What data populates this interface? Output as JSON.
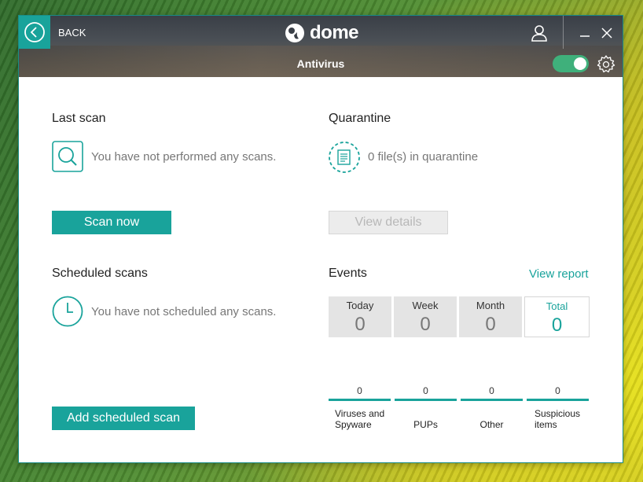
{
  "header": {
    "back_label": "BACK",
    "logo_text": "dome",
    "logo_small": "panda",
    "title": "Antivirus",
    "toggle_on": true
  },
  "last_scan": {
    "title": "Last scan",
    "message": "You have not performed any scans.",
    "button": "Scan now"
  },
  "quarantine": {
    "title": "Quarantine",
    "message": "0 file(s) in quarantine",
    "button": "View details"
  },
  "scheduled": {
    "title": "Scheduled scans",
    "message": "You have not scheduled any scans.",
    "button": "Add scheduled scan"
  },
  "events": {
    "title": "Events",
    "view_report": "View report",
    "periods": [
      {
        "label": "Today",
        "value": "0"
      },
      {
        "label": "Week",
        "value": "0"
      },
      {
        "label": "Month",
        "value": "0"
      },
      {
        "label": "Total",
        "value": "0"
      }
    ],
    "categories": [
      {
        "label": "Viruses and Spyware",
        "value": "0"
      },
      {
        "label": "PUPs",
        "value": "0"
      },
      {
        "label": "Other",
        "value": "0"
      },
      {
        "label": "Suspicious items",
        "value": "0"
      }
    ]
  },
  "colors": {
    "accent": "#19a39b",
    "toggle": "#3fb07b"
  }
}
